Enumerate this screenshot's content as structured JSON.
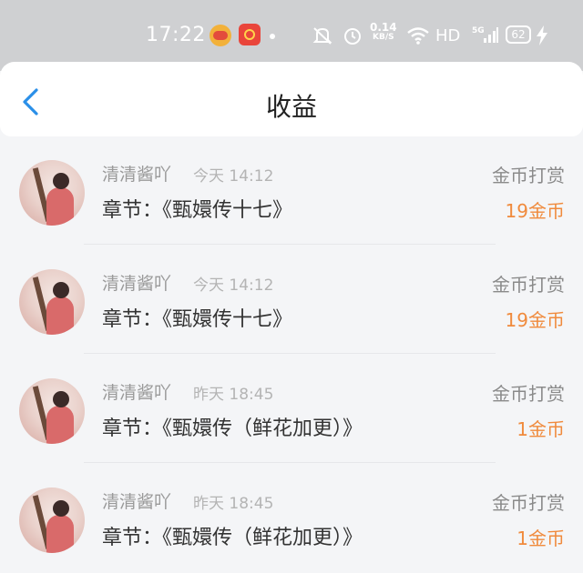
{
  "status_bar": {
    "time": "17:22",
    "net_speed_value": "0.14",
    "net_speed_unit": "KB/S",
    "hd_label": "HD",
    "signal_label": "5G",
    "battery": "62"
  },
  "header": {
    "title": "收益",
    "back_icon": "chevron-left-icon"
  },
  "items": [
    {
      "name": "清清酱吖",
      "time": "今天 14:12",
      "chapter": "章节：《甄嬛传十七》",
      "type": "金币打赏",
      "amount": "19金币"
    },
    {
      "name": "清清酱吖",
      "time": "今天 14:12",
      "chapter": "章节：《甄嬛传十七》",
      "type": "金币打赏",
      "amount": "19金币"
    },
    {
      "name": "清清酱吖",
      "time": "昨天 18:45",
      "chapter": "章节：《甄嬛传（鲜花加更）》",
      "type": "金币打赏",
      "amount": "1金币"
    },
    {
      "name": "清清酱吖",
      "time": "昨天 18:45",
      "chapter": "章节：《甄嬛传（鲜花加更）》",
      "type": "金币打赏",
      "amount": "1金币"
    }
  ],
  "colors": {
    "accent": "#2a8fe8",
    "amount": "#f08a3c",
    "status_bar_bg": "#cfd0d2"
  }
}
